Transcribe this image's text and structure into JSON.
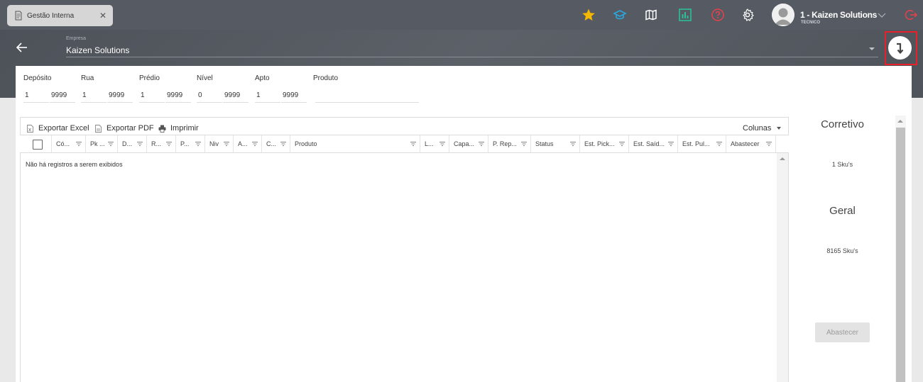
{
  "tab": {
    "title": "Gestão Interna",
    "close": "✕",
    "icon": "document-icon"
  },
  "topbar": {
    "icons": [
      "star-icon",
      "graduation-cap-icon",
      "map-icon",
      "chart-icon",
      "help-icon",
      "gear-icon"
    ],
    "user": {
      "name": "1 - Kaizen Solutions",
      "role": "TECNICO"
    },
    "colors": {
      "star": "#f5b800",
      "cap": "#29a8e0",
      "chart": "#2bbf9a",
      "help": "#e8404a",
      "logout": "#e8404a"
    }
  },
  "header": {
    "empresa_label": "Empresa",
    "empresa_value": "Kaizen Solutions",
    "download_icon": "download-arrow-icon"
  },
  "filters": {
    "deposito": {
      "label": "Depósito",
      "from": "1",
      "to": "9999"
    },
    "rua": {
      "label": "Rua",
      "from": "1",
      "to": "9999"
    },
    "predio": {
      "label": "Prédio",
      "from": "1",
      "to": "9999"
    },
    "nivel": {
      "label": "Nível",
      "from": "0",
      "to": "9999"
    },
    "apto": {
      "label": "Apto",
      "from": "1",
      "to": "9999"
    },
    "produto": {
      "label": "Produto",
      "value": ""
    }
  },
  "toolbar": {
    "excel": "Exportar Excel",
    "pdf": "Exportar PDF",
    "print": "Imprimir",
    "columns": "Colunas"
  },
  "grid": {
    "columns": [
      "Có...",
      "Pk ...",
      "D...",
      "R...",
      "P...",
      "Niv",
      "A...",
      "C...",
      "Produto",
      "L...",
      "Capa...",
      "P. Rep...",
      "Status",
      "Est. Pick...",
      "Est. Saíd...",
      "Est. Pul...",
      "Abastecer"
    ],
    "empty_message": "Não há registros a serem exibidos"
  },
  "summary": {
    "corretivo_title": "Corretivo",
    "corretivo_count": "1 Sku's",
    "geral_title": "Geral",
    "geral_count": "8165 Sku's",
    "abastecer_button": "Abastecer"
  }
}
